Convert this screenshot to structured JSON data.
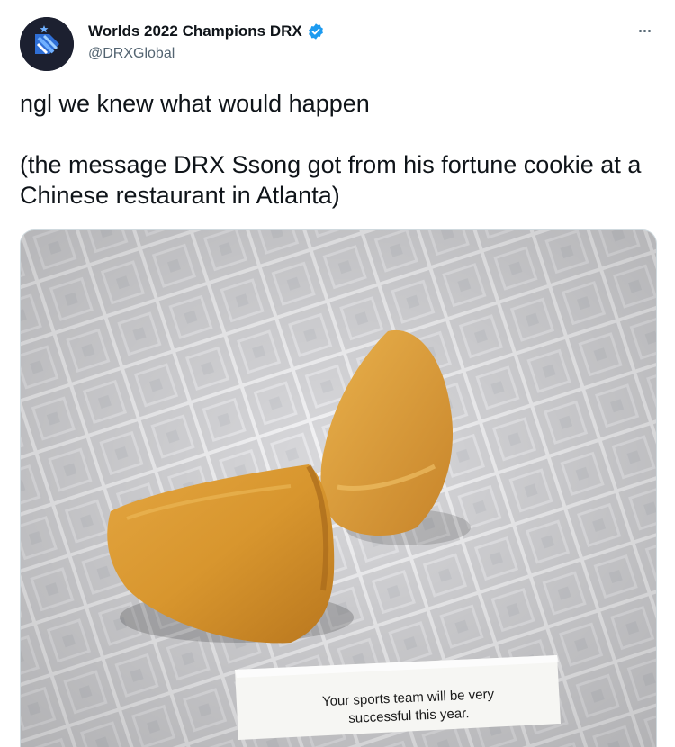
{
  "tweet": {
    "display_name": "Worlds 2022 Champions DRX",
    "handle": "@DRXGlobal",
    "verified_icon": "verified-badge-icon",
    "more_icon": "more-options-icon",
    "text": "ngl we knew what would happen\n\n(the message DRX Ssong got from his fortune cookie at a Chinese restaurant in Atlanta)",
    "media": {
      "fortune_text": "Your sports team will be very\nsuccessful this year."
    }
  },
  "colors": {
    "verified": "#1d9bf0",
    "secondary_text": "#536471",
    "primary_text": "#0f1419"
  }
}
